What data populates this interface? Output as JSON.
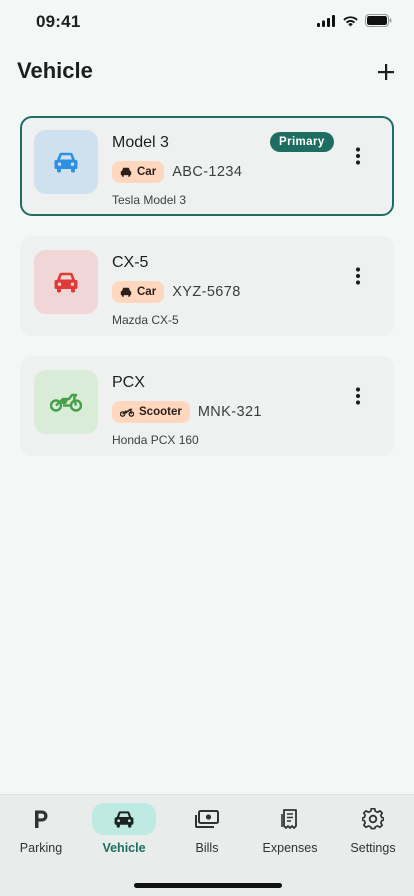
{
  "status_bar": {
    "time": "09:41"
  },
  "header": {
    "title": "Vehicle"
  },
  "vehicles": [
    {
      "name": "Model 3",
      "type_label": "Car",
      "plate": "ABC-1234",
      "model": "Tesla Model 3",
      "badge": "Primary",
      "icon": "car-icon",
      "thumb_bg": "#cfe1ef",
      "icon_color": "#2f8fe3"
    },
    {
      "name": "CX-5",
      "type_label": "Car",
      "plate": "XYZ-5678",
      "model": "Mazda CX-5",
      "icon": "car-icon",
      "thumb_bg": "#f0d6d6",
      "icon_color": "#e03a36"
    },
    {
      "name": "PCX",
      "type_label": "Scooter",
      "plate": "MNK-321",
      "model": "Honda PCX 160",
      "icon": "motorcycle-icon",
      "thumb_bg": "#d9ecd8",
      "icon_color": "#46a04a"
    }
  ],
  "nav": {
    "items": [
      {
        "label": "Parking",
        "icon": "parking-icon"
      },
      {
        "label": "Vehicle",
        "icon": "car-icon",
        "active": true
      },
      {
        "label": "Bills",
        "icon": "bills-icon"
      },
      {
        "label": "Expenses",
        "icon": "receipt-icon"
      },
      {
        "label": "Settings",
        "icon": "gear-icon"
      }
    ]
  },
  "colors": {
    "accent": "#1d6d62",
    "chip_bg": "#ffd7bf",
    "nav_active_bg": "#bfeae3"
  }
}
